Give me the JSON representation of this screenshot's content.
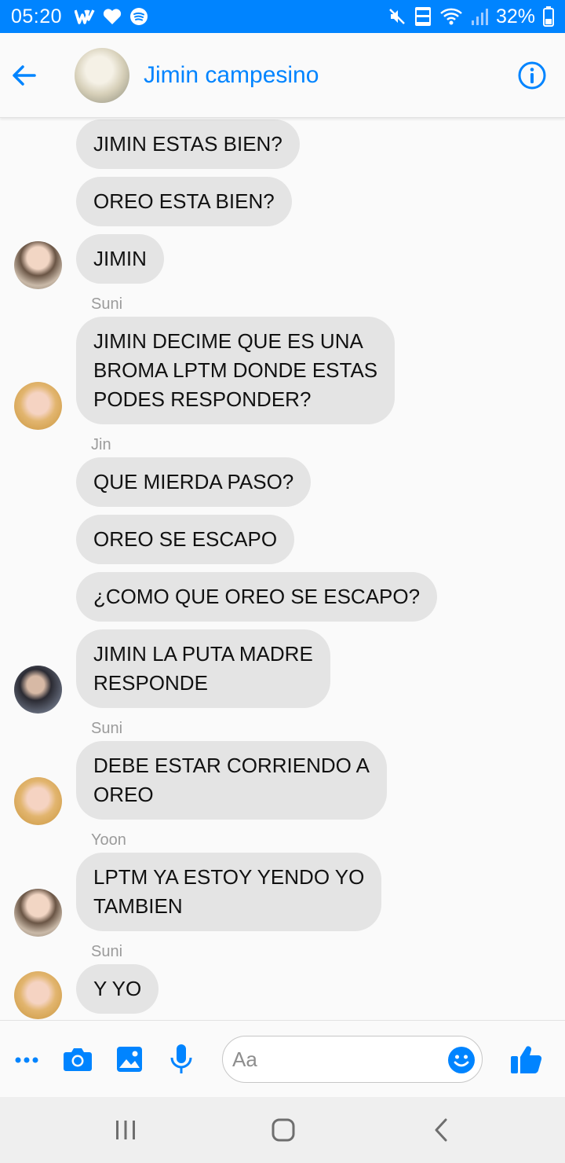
{
  "status_bar": {
    "time": "05:20",
    "battery": "32%",
    "accent": "#0084ff"
  },
  "header": {
    "title": "Jimin campesino"
  },
  "messages": [
    {
      "id": "m1",
      "text": "JIMIN ESTAS BIEN?"
    },
    {
      "id": "m2",
      "text": "OREO ESTA BIEN?"
    },
    {
      "id": "m3",
      "text": "JIMIN"
    },
    {
      "id": "s1",
      "sender": "Suni"
    },
    {
      "id": "m4",
      "text": "JIMIN DECIME QUE ES UNA\nBROMA LPTM DONDE ESTAS\nPODES RESPONDER?"
    },
    {
      "id": "s2",
      "sender": "Jin"
    },
    {
      "id": "m5",
      "text": "QUE MIERDA PASO?"
    },
    {
      "id": "m6",
      "text": "OREO SE ESCAPO"
    },
    {
      "id": "m7",
      "text": "¿COMO QUE OREO SE ESCAPO?"
    },
    {
      "id": "m8",
      "text": "JIMIN LA PUTA MADRE\nRESPONDE"
    },
    {
      "id": "s3",
      "sender": "Suni"
    },
    {
      "id": "m9",
      "text": "DEBE ESTAR CORRIENDO A\nOREO"
    },
    {
      "id": "s4",
      "sender": "Yoon"
    },
    {
      "id": "m10",
      "text": "LPTM YA ESTOY YENDO YO\nTAMBIEN"
    },
    {
      "id": "s5",
      "sender": "Suni"
    },
    {
      "id": "m11",
      "text": "Y YO"
    }
  ],
  "composer": {
    "placeholder": "Aa"
  },
  "icons": {
    "back": "arrow-left-icon",
    "info": "info-icon",
    "more": "more-dots-icon",
    "camera": "camera-icon",
    "gallery": "image-icon",
    "mic": "microphone-icon",
    "emoji": "emoji-icon",
    "like": "thumbs-up-icon"
  }
}
